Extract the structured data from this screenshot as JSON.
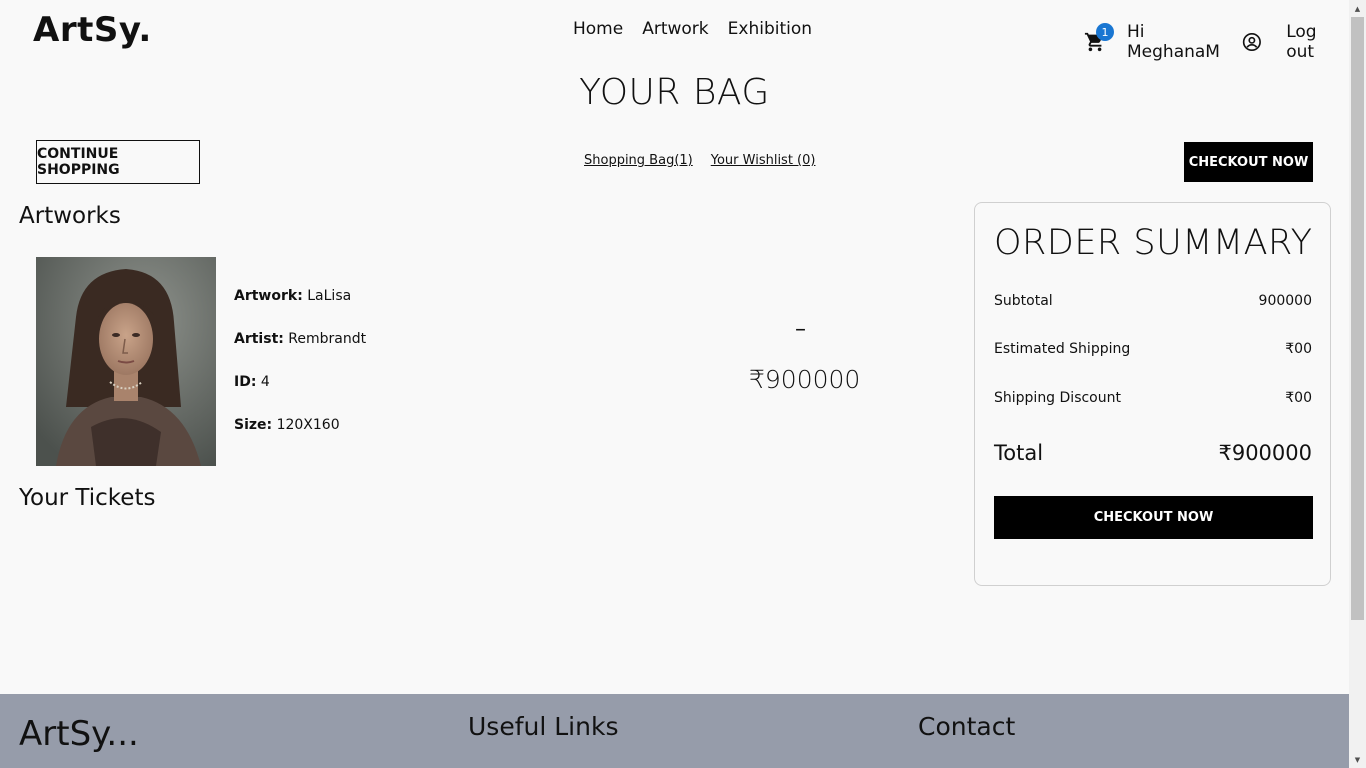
{
  "header": {
    "logo": "ArtSy.",
    "nav": [
      "Home",
      "Artwork",
      "Exhibition"
    ],
    "cart_count": "1",
    "greeting": "Hi MeghanaM",
    "logout_label": "Log out"
  },
  "page_title": "YOUR BAG",
  "actions": {
    "continue_label": "CONTINUE SHOPPING",
    "tabs": [
      "Shopping Bag(1)",
      "Your Wishlist (0)"
    ],
    "checkout_label": "CHECKOUT NOW"
  },
  "artworks": {
    "section_title": "Artworks",
    "items": [
      {
        "artwork_label": "Artwork:",
        "artwork_value": " LaLisa",
        "artist_label": "Artist:",
        "artist_value": " Rembrandt",
        "id_label": "ID:",
        "id_value": " 4",
        "size_label": "Size:",
        "size_value": " 120X160",
        "quantity_symbol": "–",
        "price": "₹900000"
      }
    ]
  },
  "tickets": {
    "section_title": "Your Tickets"
  },
  "summary": {
    "title": "ORDER SUMMARY",
    "subtotal_label": "Subtotal",
    "subtotal_value": "900000",
    "shipping_label": "Estimated Shipping",
    "shipping_value": "₹00",
    "discount_label": "Shipping Discount",
    "discount_value": "₹00",
    "total_label": "Total",
    "total_value": "₹900000",
    "checkout_label": "CHECKOUT NOW"
  },
  "footer": {
    "logo": "ArtSy...",
    "useful_links": "Useful Links",
    "contact": "Contact"
  },
  "colors": {
    "badge": "#1976d2",
    "footer_bg": "#969caa",
    "button_bg": "#000000"
  },
  "icons": {
    "cart": "shopping-cart-icon",
    "user": "account-circle-icon"
  }
}
